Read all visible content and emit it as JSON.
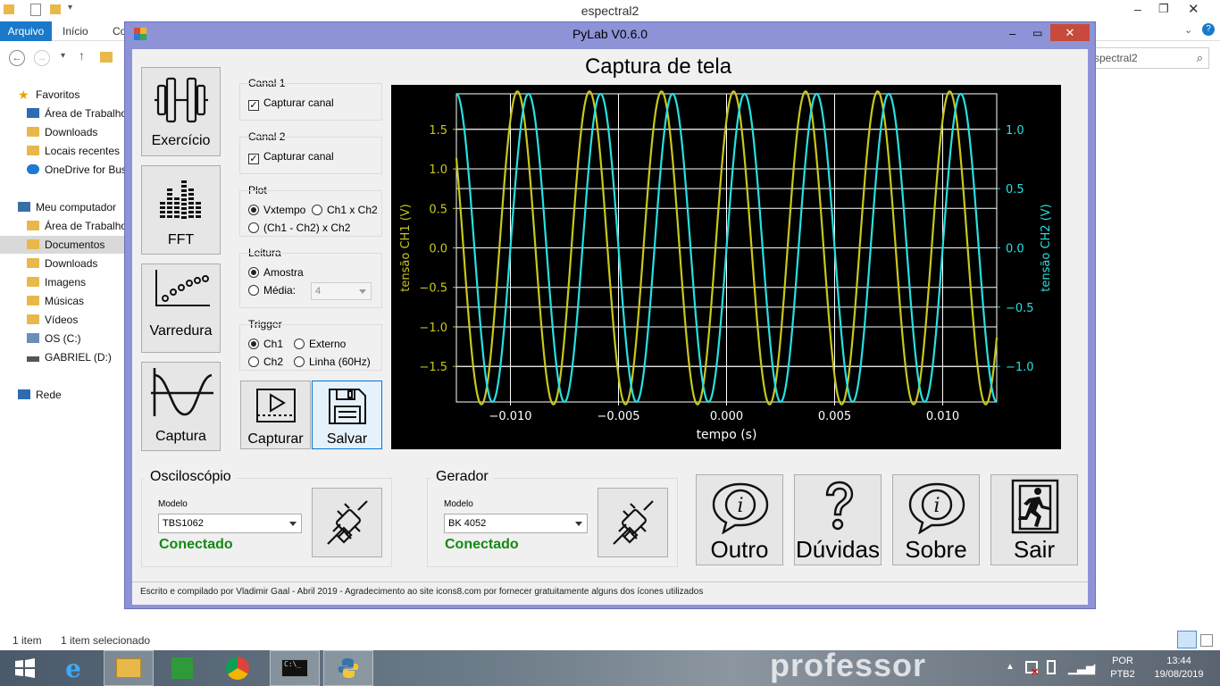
{
  "explorer": {
    "title": "espectral2",
    "tabs": {
      "file": "Arquivo",
      "home": "Início",
      "share": "Co"
    },
    "search_text": "spectral2",
    "sidebar": [
      {
        "label": "Favoritos",
        "icon": "star-icon"
      },
      {
        "label": "Área de Trabalho",
        "icon": "desktop-icon"
      },
      {
        "label": "Downloads",
        "icon": "folder-icon"
      },
      {
        "label": "Locais recentes",
        "icon": "recent-icon"
      },
      {
        "label": "OneDrive for Bus",
        "icon": "cloud-icon"
      },
      {
        "label": "Meu computador",
        "icon": "computer-icon"
      },
      {
        "label": "Área de Trabalho",
        "icon": "desktop-icon"
      },
      {
        "label": "Documentos",
        "icon": "folder-icon"
      },
      {
        "label": "Downloads",
        "icon": "folder-icon"
      },
      {
        "label": "Imagens",
        "icon": "folder-icon"
      },
      {
        "label": "Músicas",
        "icon": "folder-icon"
      },
      {
        "label": "Vídeos",
        "icon": "folder-icon"
      },
      {
        "label": "OS (C:)",
        "icon": "drive-icon"
      },
      {
        "label": "GABRIEL (D:)",
        "icon": "drive-icon"
      },
      {
        "label": "Rede",
        "icon": "network-icon"
      }
    ],
    "status_items": "1 item",
    "status_selected": "1 item selecionado"
  },
  "app": {
    "title": "PyLab V0.6.0",
    "page_title": "Captura de tela",
    "nav_buttons": {
      "exercise": "Exercício",
      "fft": "FFT",
      "sweep": "Varredura",
      "capture": "Captura"
    },
    "canal1": {
      "title": "Canal 1",
      "checkbox": "Capturar canal",
      "checked": true
    },
    "canal2": {
      "title": "Canal 2",
      "checkbox": "Capturar canal",
      "checked": true
    },
    "plot": {
      "title": "Plot",
      "opt1": "Vxtempo",
      "opt2": "Ch1 x Ch2",
      "opt3": "(Ch1 - Ch2) x Ch2",
      "selected": "Vxtempo"
    },
    "leitura": {
      "title": "Leitura",
      "opt1": "Amostra",
      "opt2": "Média:",
      "media_value": "4",
      "selected": "Amostra"
    },
    "trigger": {
      "title": "Trigger",
      "opt1": "Ch1",
      "opt2": "Externo",
      "opt3": "Ch2",
      "opt4": "Linha (60Hz)",
      "selected": "Ch1"
    },
    "action_buttons": {
      "capture": "Capturar",
      "save": "Salvar"
    },
    "oscilloscope": {
      "title": "Osciloscópio",
      "model_label": "Modelo",
      "model": "TBS1062",
      "status": "Conectado"
    },
    "generator": {
      "title": "Gerador",
      "model_label": "Modelo",
      "model": "BK 4052",
      "status": "Conectado"
    },
    "footer_buttons": {
      "other": "Outro",
      "help": "Dúvidas",
      "about": "Sobre",
      "exit": "Sair"
    },
    "credits": "Escrito e compilado por Vladimir Gaal - Abril 2019 - Agradecimento ao site icons8.com por fornecer gratuitamente alguns dos ícones utilizados"
  },
  "taskbar": {
    "lang": "POR",
    "layout": "PTB2",
    "time": "13:44",
    "date": "19/08/2019",
    "wallpaper_text": "professor"
  },
  "colors": {
    "ch1": "#c8c81e",
    "ch2": "#28e0e0",
    "connected": "#128a12",
    "titlebar": "#8e93d8"
  },
  "chart_data": {
    "type": "line",
    "title": "",
    "xlabel": "tempo (s)",
    "ylabel_left": "tensão CH1 (V)",
    "ylabel_right": "tensão CH2 (V)",
    "xlim": [
      -0.0125,
      0.0125
    ],
    "ylim_left": [
      -1.95,
      1.95
    ],
    "ylim_right": [
      -1.3,
      1.3
    ],
    "x_ticks": [
      "−0.010",
      "−0.005",
      "0.000",
      "0.005",
      "0.010"
    ],
    "x_tick_values": [
      -0.01,
      -0.005,
      0,
      0.005,
      0.01
    ],
    "y_left_ticks": [
      "1.5",
      "1.0",
      "0.5",
      "0.0",
      "−0.5",
      "−1.0",
      "−1.5"
    ],
    "y_left_tick_values": [
      1.5,
      1.0,
      0.5,
      0.0,
      -0.5,
      -1.0,
      -1.5
    ],
    "y_right_ticks": [
      "1.0",
      "0.5",
      "0.0",
      "−0.5",
      "−1.0"
    ],
    "y_right_tick_values": [
      1.0,
      0.5,
      0.0,
      -0.5,
      -1.0
    ],
    "grid": true,
    "series": [
      {
        "axis": "left",
        "amplitude": 1.98,
        "frequency_hz": 300,
        "phase_deg": 55,
        "color": "#c8c81e"
      },
      {
        "axis": "right",
        "amplitude": 1.3,
        "frequency_hz": 300,
        "phase_deg": 0,
        "color": "#28e0e0"
      }
    ]
  }
}
